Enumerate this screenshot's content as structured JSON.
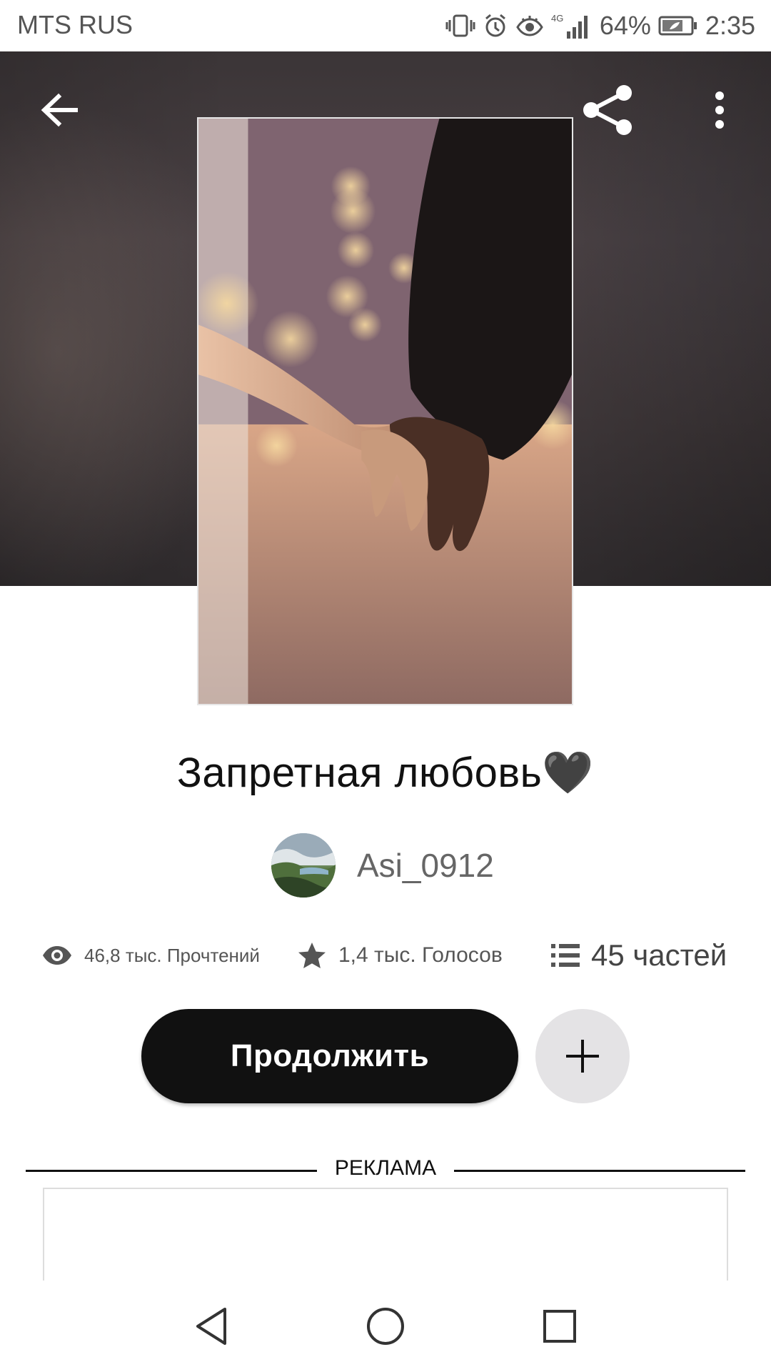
{
  "status_bar": {
    "carrier": "MTS RUS",
    "network": "4G",
    "battery_percent": "64%",
    "time": "2:35"
  },
  "toolbar": {
    "back_icon": "arrow-left-icon",
    "share_icon": "share-icon",
    "more_icon": "more-vertical-icon"
  },
  "story": {
    "title": "Запретная любовь🖤",
    "author": "Asi_0912",
    "reads": "46,8 тыс. Прочтений",
    "votes": "1,4 тыс. Голосов",
    "parts": "45 частей"
  },
  "actions": {
    "continue_label": "Продолжить",
    "add_icon": "plus-icon"
  },
  "ad": {
    "label": "РЕКЛАМА"
  },
  "nav": {
    "back_icon": "triangle-back-icon",
    "home_icon": "circle-home-icon",
    "recents_icon": "square-recents-icon"
  }
}
